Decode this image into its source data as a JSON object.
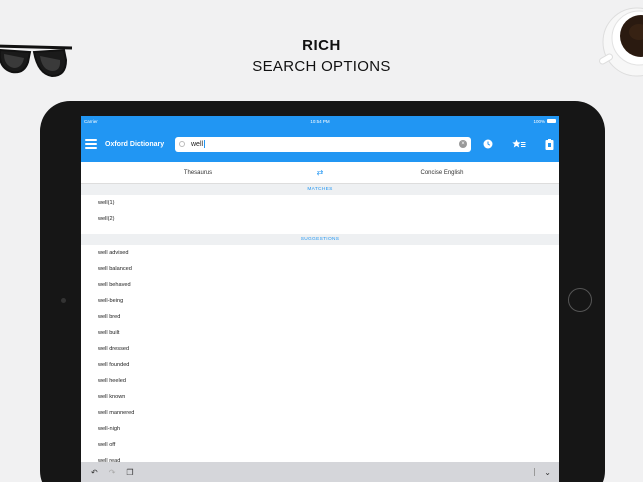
{
  "headline": {
    "line1": "RICH",
    "line2": "SEARCH OPTIONS"
  },
  "status_bar": {
    "carrier": "Carrier",
    "time": "10:54 PM",
    "battery": "100%"
  },
  "nav": {
    "app_title": "Oxford Dictionary",
    "search_value": "well",
    "clear_glyph": "×",
    "icons": [
      "menu-icon",
      "history-icon",
      "favorites-icon",
      "bookmark-icon"
    ]
  },
  "sub_tabs": {
    "left": "Thesaurus",
    "swap_glyph": "⇄",
    "right": "Concise English"
  },
  "matches": {
    "header": "MATCHES",
    "items": [
      "well(1)",
      "well(2)"
    ]
  },
  "suggestions": {
    "header": "SUGGESTIONS",
    "items": [
      "well advised",
      "well balanced",
      "well behaved",
      "well-being",
      "well bred",
      "well built",
      "well dressed",
      "well founded",
      "well heeled",
      "well known",
      "well mannered",
      "well-nigh",
      "well off",
      "well read"
    ]
  },
  "keyboard_bar": {
    "undo": "↶",
    "redo": "↷",
    "paste": "❐",
    "hide": "⌄"
  },
  "colors": {
    "accent": "#2196f3",
    "background": "#f1f1f2",
    "device": "#161616"
  }
}
